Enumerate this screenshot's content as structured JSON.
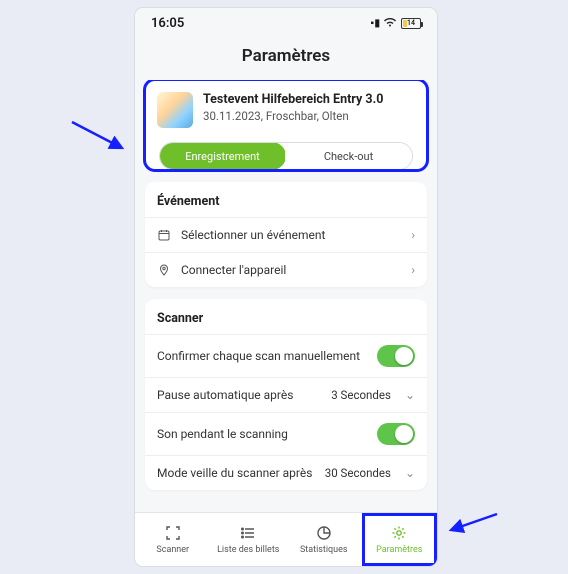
{
  "status": {
    "time": "16:05",
    "battery": "14"
  },
  "page": {
    "title": "Paramètres"
  },
  "event": {
    "title": "Testevent Hilfebereich Entry 3.0",
    "subtitle": "30.11.2023, Froschbar, Olten",
    "seg_checkin": "Enregistrement",
    "seg_checkout": "Check-out"
  },
  "sections": {
    "evenement": {
      "label": "Événement",
      "select_event": "Sélectionner un événement",
      "connect_device": "Connecter l'appareil"
    },
    "scanner": {
      "label": "Scanner",
      "confirm": "Confirmer chaque scan manuellement",
      "auto_pause": "Pause automatique après",
      "auto_pause_value": "3 Secondes",
      "sound": "Son pendant le scanning",
      "sleep": "Mode veille du scanner après",
      "sleep_value": "30 Secondes"
    }
  },
  "tabs": {
    "scanner": "Scanner",
    "tickets": "Liste des billets",
    "stats": "Statistiques",
    "settings": "Paramètres"
  }
}
